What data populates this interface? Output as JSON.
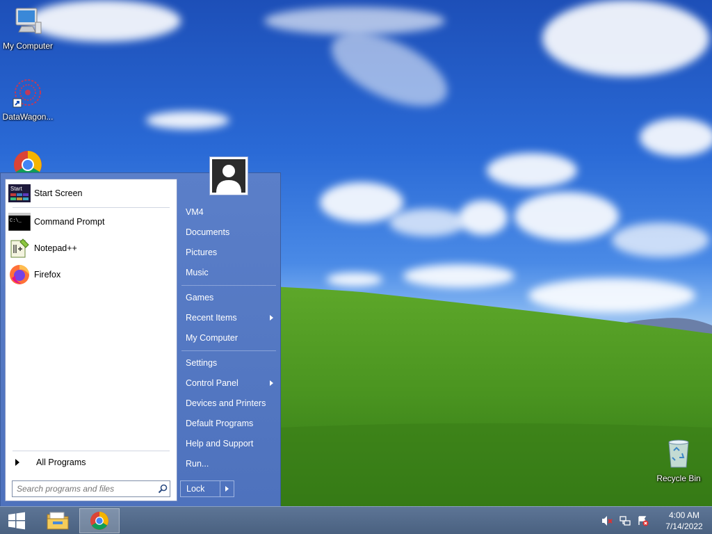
{
  "desktop": {
    "icons": [
      {
        "label": "My Computer"
      },
      {
        "label": "DataWagon..."
      },
      {
        "label": "Recycle Bin"
      }
    ]
  },
  "start_menu": {
    "pinned": [
      {
        "label": "Start Screen",
        "icon": "start-screen-icon"
      },
      {
        "label": "Command Prompt",
        "icon": "command-prompt-icon"
      },
      {
        "label": "Notepad++",
        "icon": "notepadpp-icon"
      },
      {
        "label": "Firefox",
        "icon": "firefox-icon"
      }
    ],
    "start_screen_icon_text": "Start",
    "cmd_icon_text": "C:\\_",
    "all_programs": "All Programs",
    "search_placeholder": "Search programs and files",
    "right_items": [
      {
        "label": "VM4"
      },
      {
        "label": "Documents"
      },
      {
        "label": "Pictures"
      },
      {
        "label": "Music"
      },
      {
        "label": "Games"
      },
      {
        "label": "Recent Items",
        "submenu": true
      },
      {
        "label": "My Computer"
      },
      {
        "label": "Settings"
      },
      {
        "label": "Control Panel",
        "submenu": true
      },
      {
        "label": "Devices and Printers"
      },
      {
        "label": "Default Programs"
      },
      {
        "label": "Help and Support"
      },
      {
        "label": "Run..."
      }
    ],
    "lock_label": "Lock"
  },
  "taskbar": {
    "clock_time": "4:00 AM",
    "clock_date": "7/14/2022",
    "apps": [
      {
        "name": "file-explorer-icon"
      },
      {
        "name": "chrome-icon",
        "active": true
      }
    ],
    "tray": [
      "volume-muted-icon",
      "network-icon",
      "action-center-alert-icon"
    ]
  },
  "colors": {
    "menu_blue": "#4e72bd",
    "taskbar": "#4a6180",
    "sky": "#2a6ad6",
    "grass": "#4f9a1e"
  }
}
